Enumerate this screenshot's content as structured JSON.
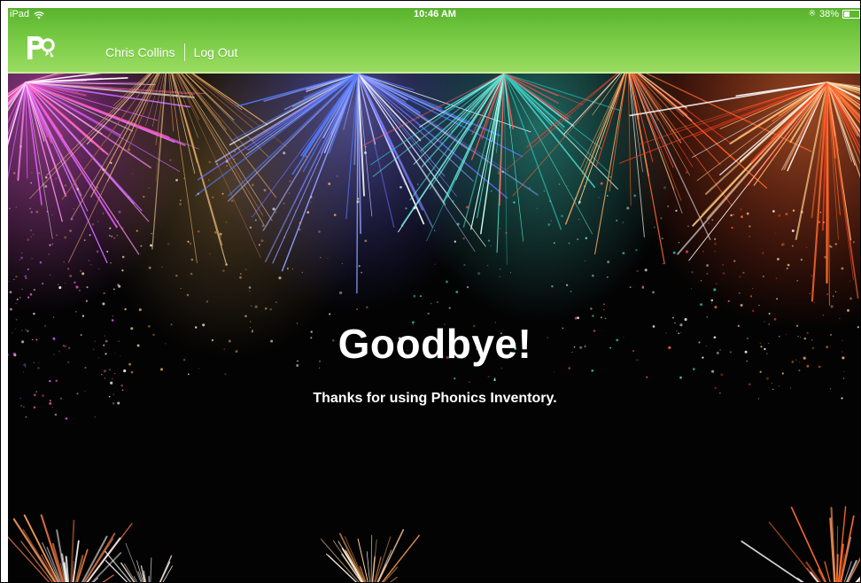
{
  "status_bar": {
    "device": "iPad",
    "time": "10:46 AM",
    "battery": "38%",
    "battery_level": 0.38,
    "icons": [
      "wifi-icon",
      "bluetooth-icon",
      "battery-icon"
    ]
  },
  "header": {
    "logo_icon": "phonics-inventory-logo",
    "user_name": "Chris Collins",
    "logout_label": "Log Out",
    "bar_color": "#6cc33b"
  },
  "main": {
    "headline": "Goodbye!",
    "subtext": "Thanks for using Phonics Inventory.",
    "background": "fireworks-image"
  }
}
